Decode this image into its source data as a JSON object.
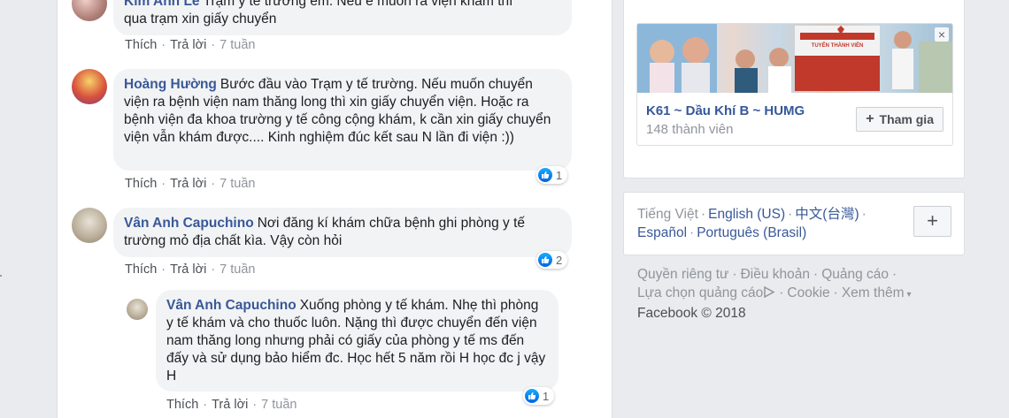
{
  "comments": [
    {
      "author": "Kim Anh Le",
      "text": "Trạm y tế trường em. Nếu e muốn ra viện khám thì qua trạm xin giấy chuyển",
      "line1": "Trạm y tế trường em. Nếu e muốn ra viện khám thì",
      "line2": "qua trạm xin giấy chuyển",
      "like": "Thích",
      "reply": "Trả lời",
      "time": "7 tuần"
    },
    {
      "author": "Hoàng Hường",
      "text": "Bước đầu vào Trạm y tế trường. Nếu muốn chuyển viện ra bệnh viện nam thăng long thì xin giấy chuyển viện. Hoặc ra bệnh viện đa khoa trường y tế công cộng khám, k cần xin giấy chuyển viện vẫn khám được.... Kinh nghiệm đúc kết sau N lần đi viện :))",
      "like": "Thích",
      "reply": "Trả lời",
      "time": "7 tuần",
      "reactions": "1"
    },
    {
      "author": "Vân Anh Capuchino",
      "text": "Nơi đăng kí khám chữa bệnh ghi phòng y tế trường mỏ địa chất kìa. Vậy còn hỏi",
      "like": "Thích",
      "reply": "Trả lời",
      "time": "7 tuần",
      "reactions": "2"
    },
    {
      "author": "Vân Anh Capuchino",
      "text": "Xuống phòng y tế khám. Nhẹ thì phòng y tế khám và cho thuốc luôn. Nặng thì được chuyển đến viện nam thăng long nhưng phải có giấy của phòng y tế ms đến đấy và sử dụng bảo hiểm đc. Học hết 5 năm rồi H học đc j vậy H",
      "like": "Thích",
      "reply": "Trả lời",
      "time": "7 tuần",
      "reactions": "1"
    }
  ],
  "group": {
    "name": "K61 ~ Dầu Khí B ~ HUMG",
    "members": "148 thành viên",
    "join_label": "Tham gia",
    "banner_text": "TUYỂN THÀNH VIÊN"
  },
  "languages": {
    "current": "Tiếng Việt",
    "options": [
      "English (US)",
      "中文(台灣)",
      "Español",
      "Português (Brasil)"
    ]
  },
  "footer": {
    "links": [
      "Quyền riêng tư",
      "Điều khoản",
      "Quảng cáo",
      "Lựa chọn quảng cáo",
      "Cookie",
      "Xem thêm"
    ],
    "copyright": "Facebook © 2018"
  },
  "colors": {
    "link": "#385898",
    "like_blue": "#1877f2",
    "bubble": "#f2f3f5",
    "page_bg": "#e9ebee"
  },
  "icons": [
    "like-icon",
    "adchoices-icon",
    "caret-down-icon",
    "plus-icon",
    "close-icon"
  ]
}
